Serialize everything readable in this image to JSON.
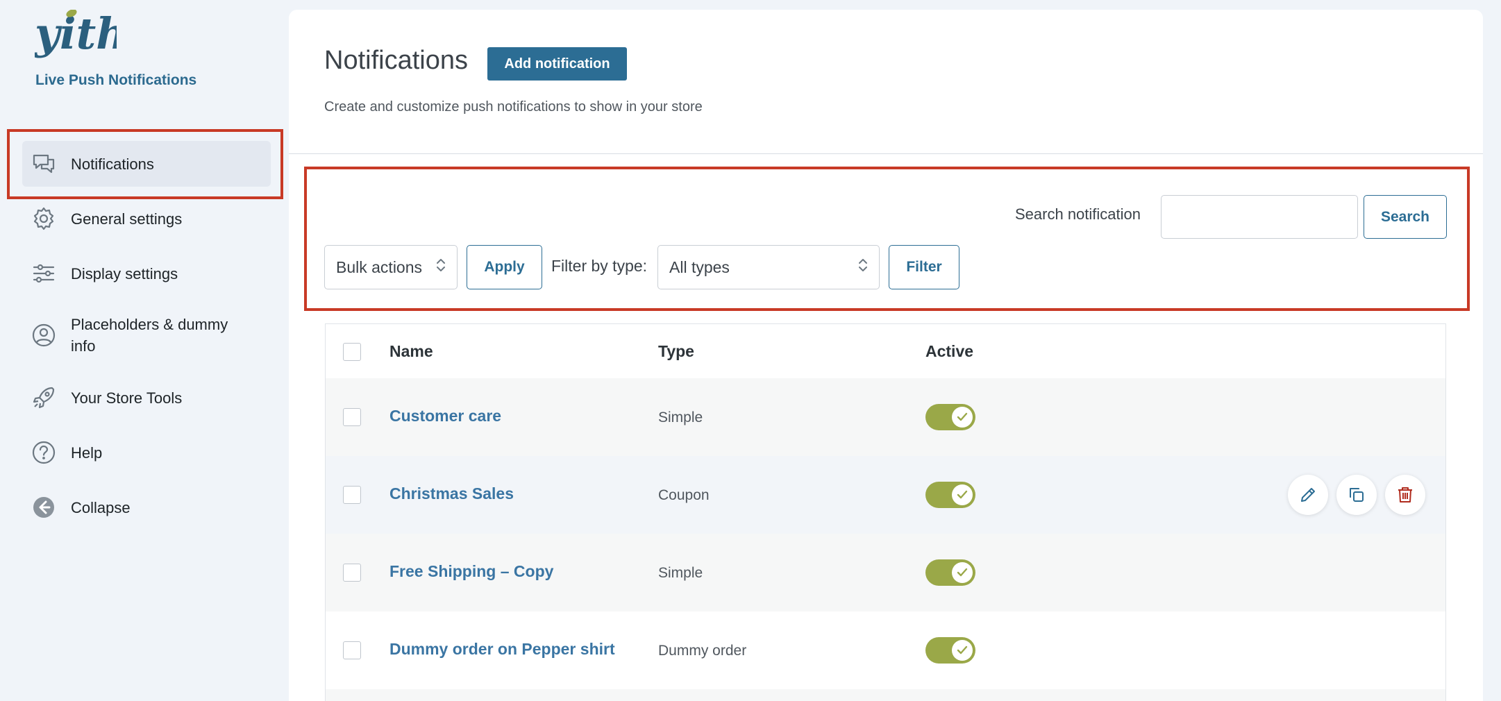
{
  "sidebar": {
    "logo_text": "yith",
    "plugin_name": "Live Push Notifications",
    "items": [
      {
        "label": "Notifications",
        "icon": "chat-bubbles-icon",
        "active": true
      },
      {
        "label": "General settings",
        "icon": "gear-icon"
      },
      {
        "label": "Display settings",
        "icon": "sliders-icon"
      },
      {
        "label": "Placeholders & dummy info",
        "icon": "user-circle-icon"
      },
      {
        "label": "Your Store Tools",
        "icon": "rocket-icon"
      },
      {
        "label": "Help",
        "icon": "question-circle-icon"
      },
      {
        "label": "Collapse",
        "icon": "arrow-left-circle-icon"
      }
    ]
  },
  "header": {
    "title": "Notifications",
    "add_button": "Add notification",
    "subtitle": "Create and customize push notifications to show in your store"
  },
  "toolbar": {
    "search_label": "Search notification",
    "search_value": "",
    "search_button": "Search",
    "bulk_actions": "Bulk actions",
    "apply_button": "Apply",
    "filter_label": "Filter by type:",
    "filter_value": "All types",
    "filter_button": "Filter"
  },
  "table": {
    "columns": [
      "Name",
      "Type",
      "Active"
    ],
    "rows": [
      {
        "name": "Customer care",
        "type": "Simple",
        "active": true
      },
      {
        "name": "Christmas Sales",
        "type": "Coupon",
        "active": true,
        "hovered": true
      },
      {
        "name": "Free Shipping – Copy",
        "type": "Simple",
        "active": true
      },
      {
        "name": "Dummy order on Pepper shirt",
        "type": "Dummy order",
        "active": true
      }
    ],
    "row_actions": [
      "edit-pencil-icon",
      "duplicate-icon",
      "trash-icon"
    ]
  },
  "colors": {
    "accent": "#2c6d94",
    "toggle_on": "#9aa848",
    "highlight": "#c83a26",
    "link": "#3a75a3"
  }
}
